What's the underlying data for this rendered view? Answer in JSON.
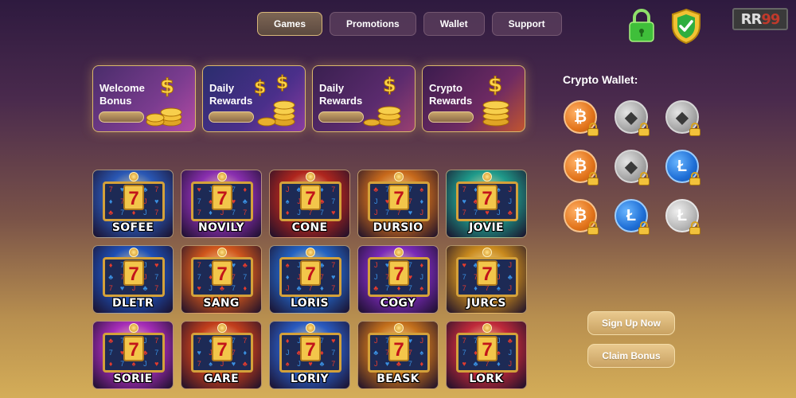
{
  "nav": {
    "items": [
      {
        "label": "Games",
        "active": true
      },
      {
        "label": "Promotions",
        "active": false
      },
      {
        "label": "Wallet",
        "active": false
      },
      {
        "label": "Support",
        "active": false
      }
    ]
  },
  "header_icons": {
    "lock": "lock-icon",
    "shield": "shield-check-icon",
    "logo": {
      "prefix": "RR",
      "digits": "99"
    }
  },
  "promos": [
    {
      "title": "Welcome Bonus"
    },
    {
      "title": "Daily Rewards"
    },
    {
      "title": "Daily Rewards"
    },
    {
      "title": "Crypto Rewards"
    }
  ],
  "games": [
    {
      "name": "SOFEE",
      "theme": "#2a58b5"
    },
    {
      "name": "NOVILY",
      "theme": "#8a2fb0"
    },
    {
      "name": "CONE",
      "theme": "#b0261e"
    },
    {
      "name": "DURSIO",
      "theme": "#c86a1c"
    },
    {
      "name": "JOVIE",
      "theme": "#1f9a8a"
    },
    {
      "name": "DLETR",
      "theme": "#1e4fb5"
    },
    {
      "name": "SANG",
      "theme": "#d0561c"
    },
    {
      "name": "LORIS",
      "theme": "#2463c2"
    },
    {
      "name": "COGY",
      "theme": "#7a2ab8"
    },
    {
      "name": "JURCS",
      "theme": "#c98a1e"
    },
    {
      "name": "SORIE",
      "theme": "#a62db8"
    },
    {
      "name": "GARE",
      "theme": "#c23e1c"
    },
    {
      "name": "LORIY",
      "theme": "#2a5bc0"
    },
    {
      "name": "BEASK",
      "theme": "#c4701c"
    },
    {
      "name": "LORK",
      "theme": "#c02a3a"
    }
  ],
  "crypto_wallet": {
    "title": "Crypto Wallet:",
    "coins": [
      {
        "type": "bitcoin-icon",
        "symbol": "₿",
        "style": "btc"
      },
      {
        "type": "ethereum-icon",
        "symbol": "◆",
        "style": "eth"
      },
      {
        "type": "ethereum-icon",
        "symbol": "◆",
        "style": "eth"
      },
      {
        "type": "bitcoin-icon",
        "symbol": "₿",
        "style": "btc"
      },
      {
        "type": "ethereum-icon",
        "symbol": "◆",
        "style": "eth"
      },
      {
        "type": "litecoin-icon",
        "symbol": "Ł",
        "style": "ltcb"
      },
      {
        "type": "bitcoin-icon",
        "symbol": "₿",
        "style": "btc"
      },
      {
        "type": "litecoin-icon",
        "symbol": "Ł",
        "style": "ltcb"
      },
      {
        "type": "litecoin-icon",
        "symbol": "Ł",
        "style": "ltcs"
      }
    ]
  },
  "actions": {
    "signup": "Sign Up Now",
    "claim": "Claim Bonus"
  }
}
